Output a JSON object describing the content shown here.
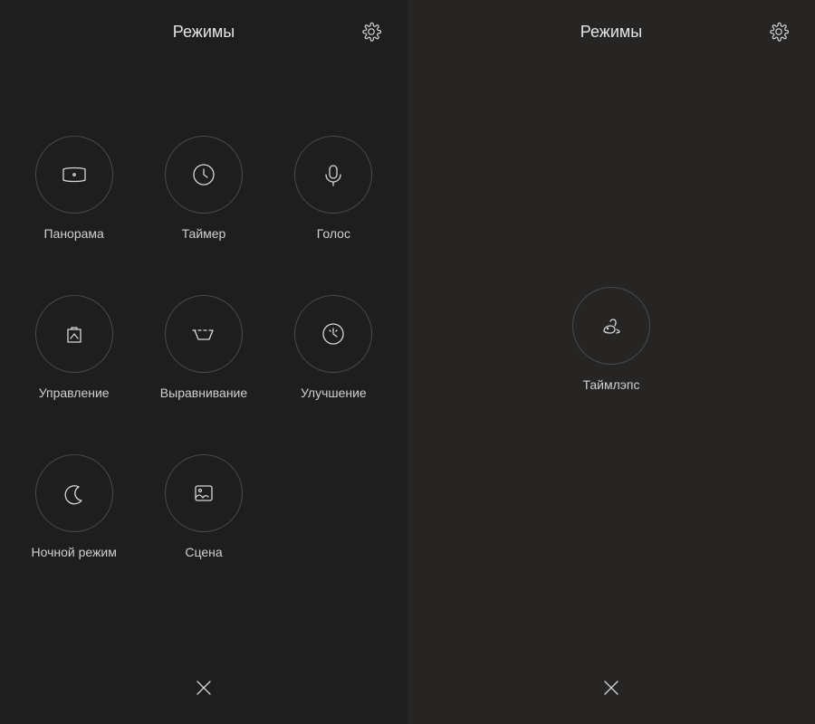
{
  "left": {
    "title": "Режимы",
    "modes": [
      {
        "id": "panorama",
        "label": "Панорама",
        "icon": "panorama-icon"
      },
      {
        "id": "timer",
        "label": "Таймер",
        "icon": "timer-icon"
      },
      {
        "id": "voice",
        "label": "Голос",
        "icon": "voice-icon"
      },
      {
        "id": "manual",
        "label": "Управление",
        "icon": "manual-icon"
      },
      {
        "id": "straighten",
        "label": "Выравнивание",
        "icon": "straighten-icon"
      },
      {
        "id": "beautify",
        "label": "Улучшение",
        "icon": "beautify-icon"
      },
      {
        "id": "night",
        "label": "Ночной режим",
        "icon": "night-icon"
      },
      {
        "id": "scene",
        "label": "Сцена",
        "icon": "scene-icon"
      }
    ]
  },
  "right": {
    "title": "Режимы",
    "modes": [
      {
        "id": "timelapse",
        "label": "Таймлэпс",
        "icon": "timelapse-icon"
      }
    ]
  },
  "icons": {
    "settings": "gear-icon",
    "close": "close-icon"
  }
}
